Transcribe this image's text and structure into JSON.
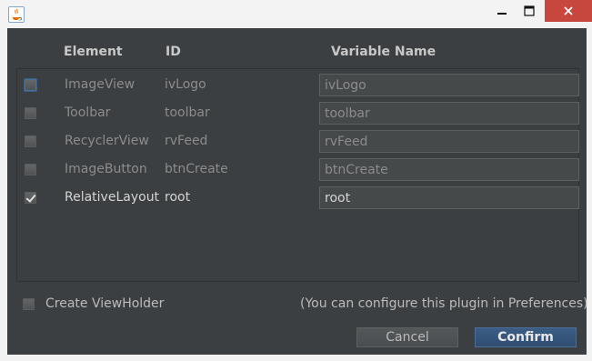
{
  "window": {
    "app_icon": "java-coffee-cup-icon",
    "controls": {
      "minimize": "minimize-icon",
      "maximize": "maximize-icon",
      "close": "close-icon"
    }
  },
  "table": {
    "headers": {
      "element": "Element",
      "id": "ID",
      "variable_name": "Variable Name"
    },
    "rows": [
      {
        "element": "ImageView",
        "id": "ivLogo",
        "variable_name": "ivLogo",
        "checked": false
      },
      {
        "element": "Toolbar",
        "id": "toolbar",
        "variable_name": "toolbar",
        "checked": false
      },
      {
        "element": "RecyclerView",
        "id": "rvFeed",
        "variable_name": "rvFeed",
        "checked": false
      },
      {
        "element": "ImageButton",
        "id": "btnCreate",
        "variable_name": "btnCreate",
        "checked": false
      },
      {
        "element": "RelativeLayout",
        "id": "root",
        "variable_name": "root",
        "checked": true
      }
    ]
  },
  "footer": {
    "create_viewholder_label": "Create ViewHolder",
    "create_viewholder_checked": false,
    "hint": "(You can configure this plugin in Preferences)"
  },
  "buttons": {
    "cancel": "Cancel",
    "confirm": "Confirm"
  },
  "colors": {
    "background": "#3c3f41",
    "accent": "#365880",
    "close": "#c7463d"
  }
}
